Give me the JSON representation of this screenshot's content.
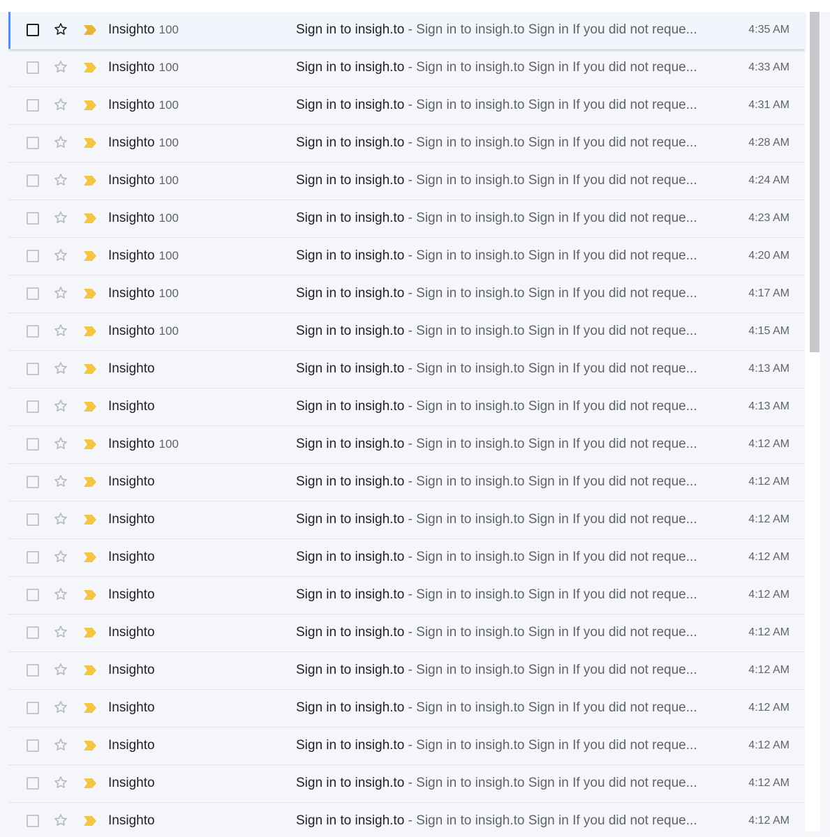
{
  "colors": {
    "important_marker": "#f4c542",
    "focus_accent": "#5b8df0",
    "background": "#f4f6fa"
  },
  "icons": {
    "checkbox": "checkbox-icon",
    "star": "star-outline-icon",
    "important": "important-marker-icon"
  },
  "emails": [
    {
      "sender": "Insighto",
      "count": "100",
      "subject": "Sign in to insigh.to",
      "separator": "-",
      "snippet": "Sign in to insigh.to Sign in If you did not reque...",
      "time": "4:35 AM"
    },
    {
      "sender": "Insighto",
      "count": "100",
      "subject": "Sign in to insigh.to",
      "separator": "-",
      "snippet": "Sign in to insigh.to Sign in If you did not reque...",
      "time": "4:33 AM"
    },
    {
      "sender": "Insighto",
      "count": "100",
      "subject": "Sign in to insigh.to",
      "separator": "-",
      "snippet": "Sign in to insigh.to Sign in If you did not reque...",
      "time": "4:31 AM"
    },
    {
      "sender": "Insighto",
      "count": "100",
      "subject": "Sign in to insigh.to",
      "separator": "-",
      "snippet": "Sign in to insigh.to Sign in If you did not reque...",
      "time": "4:28 AM"
    },
    {
      "sender": "Insighto",
      "count": "100",
      "subject": "Sign in to insigh.to",
      "separator": "-",
      "snippet": "Sign in to insigh.to Sign in If you did not reque...",
      "time": "4:24 AM"
    },
    {
      "sender": "Insighto",
      "count": "100",
      "subject": "Sign in to insigh.to",
      "separator": "-",
      "snippet": "Sign in to insigh.to Sign in If you did not reque...",
      "time": "4:23 AM"
    },
    {
      "sender": "Insighto",
      "count": "100",
      "subject": "Sign in to insigh.to",
      "separator": "-",
      "snippet": "Sign in to insigh.to Sign in If you did not reque...",
      "time": "4:20 AM"
    },
    {
      "sender": "Insighto",
      "count": "100",
      "subject": "Sign in to insigh.to",
      "separator": "-",
      "snippet": "Sign in to insigh.to Sign in If you did not reque...",
      "time": "4:17 AM"
    },
    {
      "sender": "Insighto",
      "count": "100",
      "subject": "Sign in to insigh.to",
      "separator": "-",
      "snippet": "Sign in to insigh.to Sign in If you did not reque...",
      "time": "4:15 AM"
    },
    {
      "sender": "Insighto",
      "count": "",
      "subject": "Sign in to insigh.to",
      "separator": "-",
      "snippet": "Sign in to insigh.to Sign in If you did not reque...",
      "time": "4:13 AM"
    },
    {
      "sender": "Insighto",
      "count": "",
      "subject": "Sign in to insigh.to",
      "separator": "-",
      "snippet": "Sign in to insigh.to Sign in If you did not reque...",
      "time": "4:13 AM"
    },
    {
      "sender": "Insighto",
      "count": "100",
      "subject": "Sign in to insigh.to",
      "separator": "-",
      "snippet": "Sign in to insigh.to Sign in If you did not reque...",
      "time": "4:12 AM"
    },
    {
      "sender": "Insighto",
      "count": "",
      "subject": "Sign in to insigh.to",
      "separator": "-",
      "snippet": "Sign in to insigh.to Sign in If you did not reque...",
      "time": "4:12 AM"
    },
    {
      "sender": "Insighto",
      "count": "",
      "subject": "Sign in to insigh.to",
      "separator": "-",
      "snippet": "Sign in to insigh.to Sign in If you did not reque...",
      "time": "4:12 AM"
    },
    {
      "sender": "Insighto",
      "count": "",
      "subject": "Sign in to insigh.to",
      "separator": "-",
      "snippet": "Sign in to insigh.to Sign in If you did not reque...",
      "time": "4:12 AM"
    },
    {
      "sender": "Insighto",
      "count": "",
      "subject": "Sign in to insigh.to",
      "separator": "-",
      "snippet": "Sign in to insigh.to Sign in If you did not reque...",
      "time": "4:12 AM"
    },
    {
      "sender": "Insighto",
      "count": "",
      "subject": "Sign in to insigh.to",
      "separator": "-",
      "snippet": "Sign in to insigh.to Sign in If you did not reque...",
      "time": "4:12 AM"
    },
    {
      "sender": "Insighto",
      "count": "",
      "subject": "Sign in to insigh.to",
      "separator": "-",
      "snippet": "Sign in to insigh.to Sign in If you did not reque...",
      "time": "4:12 AM"
    },
    {
      "sender": "Insighto",
      "count": "",
      "subject": "Sign in to insigh.to",
      "separator": "-",
      "snippet": "Sign in to insigh.to Sign in If you did not reque...",
      "time": "4:12 AM"
    },
    {
      "sender": "Insighto",
      "count": "",
      "subject": "Sign in to insigh.to",
      "separator": "-",
      "snippet": "Sign in to insigh.to Sign in If you did not reque...",
      "time": "4:12 AM"
    },
    {
      "sender": "Insighto",
      "count": "",
      "subject": "Sign in to insigh.to",
      "separator": "-",
      "snippet": "Sign in to insigh.to Sign in If you did not reque...",
      "time": "4:12 AM"
    },
    {
      "sender": "Insighto",
      "count": "",
      "subject": "Sign in to insigh.to",
      "separator": "-",
      "snippet": "Sign in to insigh.to Sign in If you did not reque...",
      "time": "4:12 AM"
    }
  ]
}
